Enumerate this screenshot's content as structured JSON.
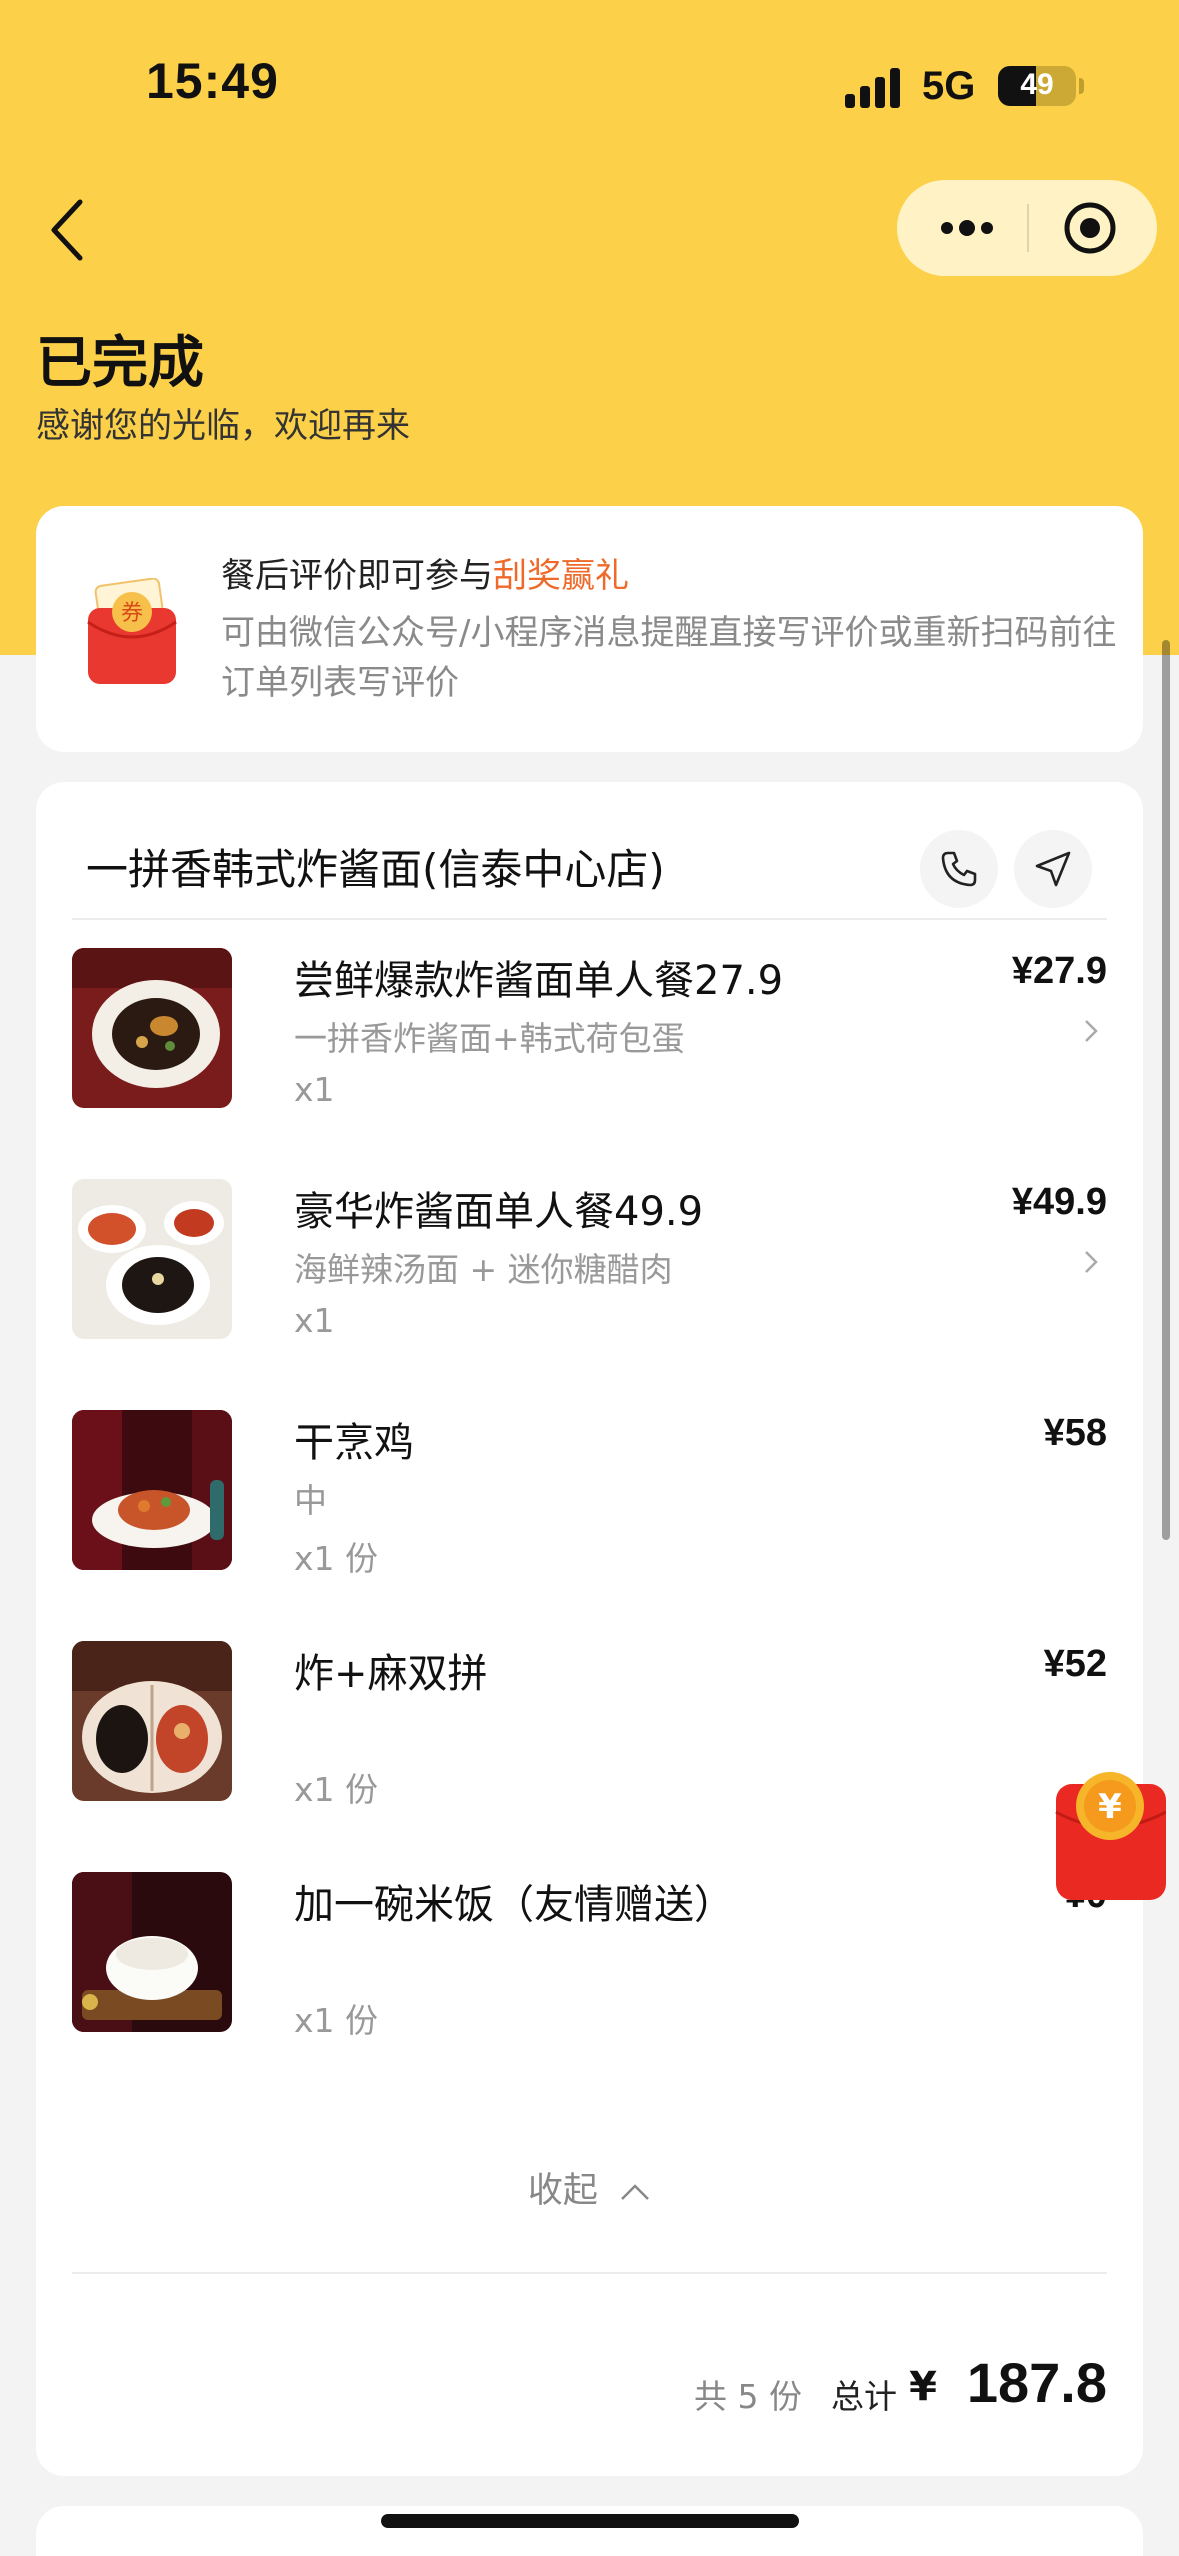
{
  "status_bar": {
    "time": "15:49",
    "network": "5G",
    "battery": "49",
    "battery_level": 0.49
  },
  "header": {
    "title": "已完成",
    "subtitle": "感谢您的光临，欢迎再来"
  },
  "promo": {
    "title_prefix": "餐后评价即可参与",
    "title_highlight": "刮奖赢礼",
    "description": "可由微信公众号/小程序消息提醒直接写评价或重新扫码前往订单列表写评价",
    "icon_text": "券"
  },
  "order": {
    "store_name": "一拼香韩式炸酱面(信泰中心店)",
    "items": [
      {
        "name": "尝鲜爆款炸酱面单人餐27.9",
        "spec": "一拼香炸酱面+韩式荷包蛋",
        "qty": "x1",
        "price": "¥27.9"
      },
      {
        "name": "豪华炸酱面单人餐49.9",
        "spec": "海鲜辣汤面 + 迷你糖醋肉",
        "qty": "x1",
        "price": "¥49.9"
      },
      {
        "name": "干烹鸡",
        "spec": "中",
        "qty": "x1 份",
        "price": "¥58"
      },
      {
        "name": "炸+麻双拼",
        "spec": "",
        "qty": "x1 份",
        "price": "¥52"
      },
      {
        "name": "加一碗米饭（友情赠送）",
        "spec": "",
        "qty": "x1 份",
        "price": "¥0"
      }
    ],
    "collapse_label": "收起",
    "total_count": "共 5 份",
    "total_label": "总计",
    "total_currency": "¥",
    "total_amount": "187.8"
  },
  "floating": {
    "icon_text": "¥"
  },
  "colors": {
    "header_yellow": "#fcd149",
    "accent_orange": "#ef6a2a",
    "muted_text": "#999999"
  }
}
